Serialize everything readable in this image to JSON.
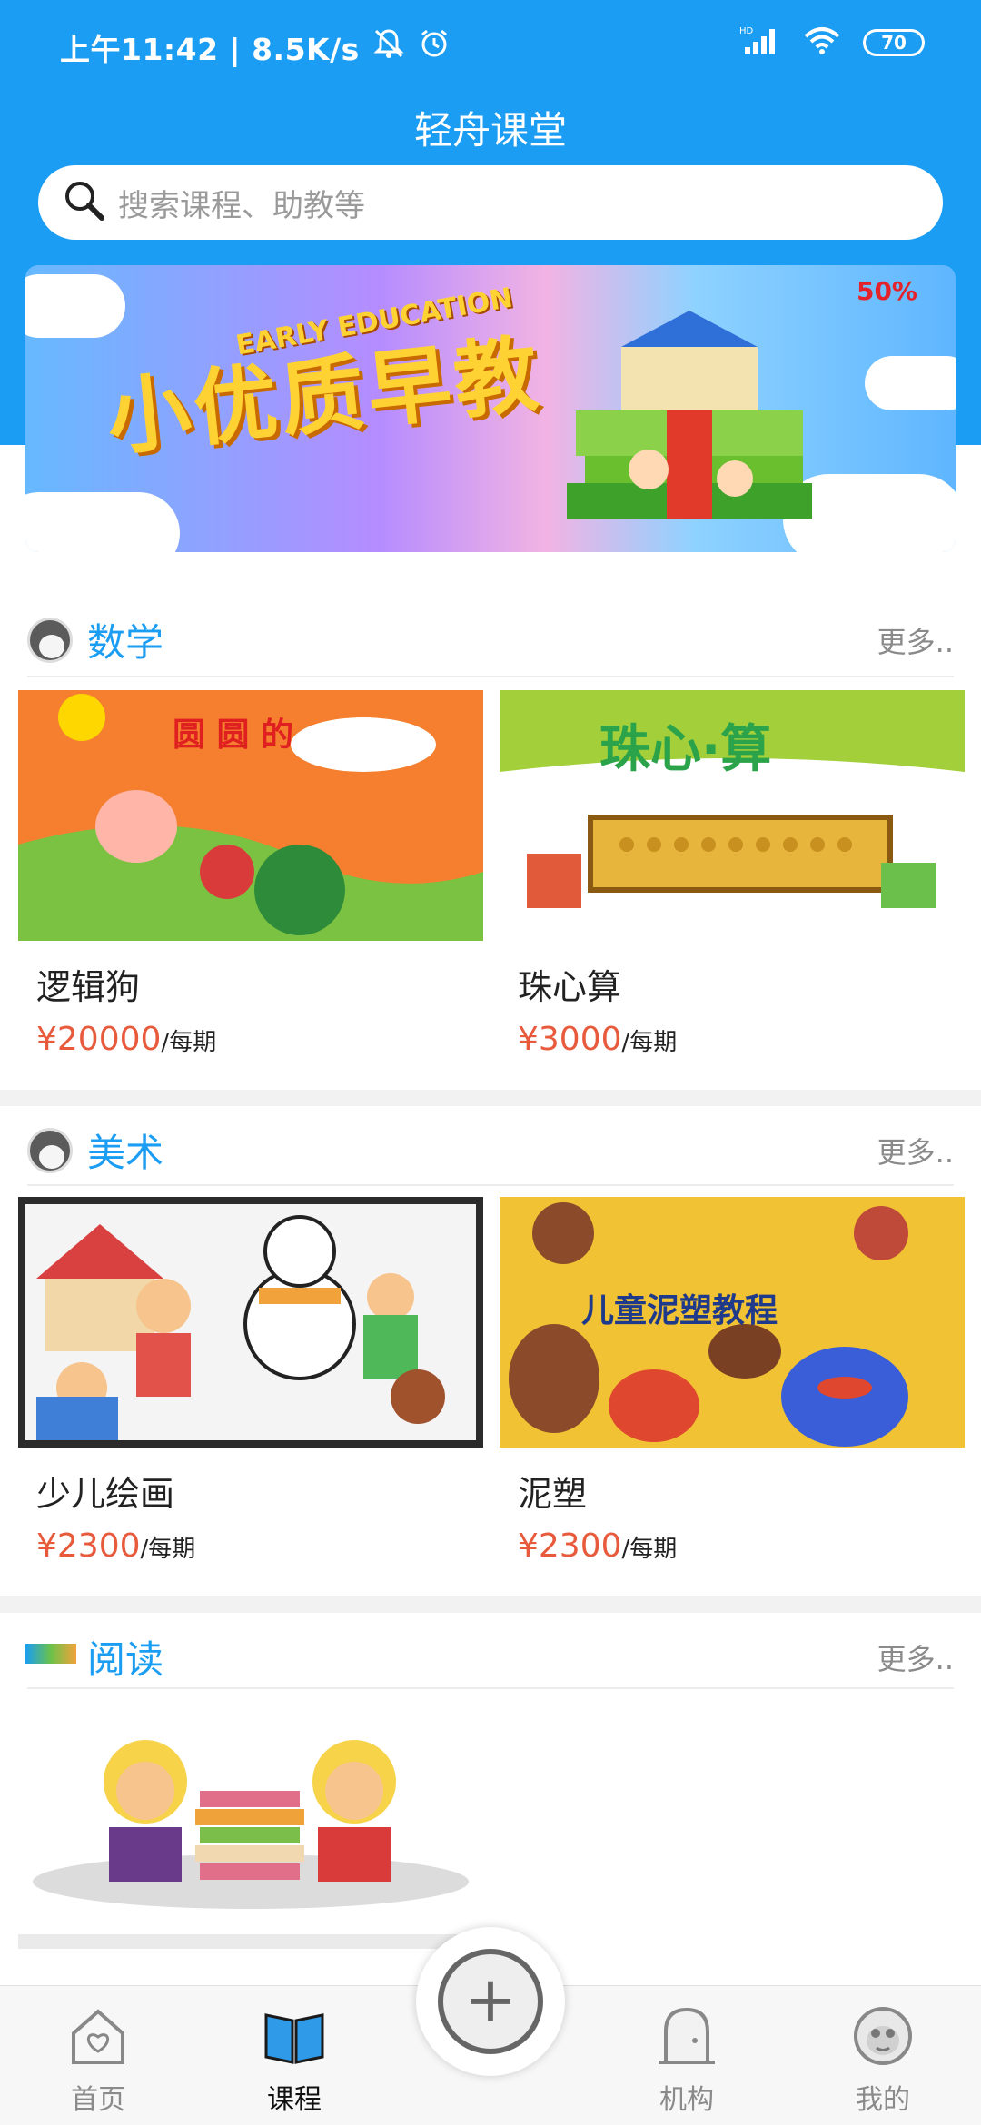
{
  "status_bar": {
    "time_info": "上午11:42 | 8.5K/s",
    "network": "HD",
    "battery": "70"
  },
  "header": {
    "title": "轻舟课堂",
    "search_placeholder": "搜索课程、助教等"
  },
  "banner": {
    "title_art": "小优质早教",
    "sub_art": "EARLY EDUCATION",
    "badge": "50%"
  },
  "sections": [
    {
      "title": "数学",
      "more": "更多..",
      "cards": [
        {
          "name": "逻辑狗",
          "price": "¥20000",
          "per": "/每期"
        },
        {
          "name": "珠心算",
          "price": "¥3000",
          "per": "/每期"
        }
      ]
    },
    {
      "title": "美术",
      "more": "更多..",
      "cards": [
        {
          "name": "少儿绘画",
          "price": "¥2300",
          "per": "/每期"
        },
        {
          "name": "泥塑",
          "price": "¥2300",
          "per": "/每期"
        }
      ]
    },
    {
      "title": "阅读",
      "more": "更多..",
      "cards": []
    }
  ],
  "card_art": {
    "c0": "圆 圆 的",
    "c1": "珠心·算",
    "c3": "儿童泥塑教程"
  },
  "bottom_nav": [
    {
      "label": "首页",
      "icon": "home-heart-icon",
      "active": false
    },
    {
      "label": "课程",
      "icon": "book-icon",
      "active": true
    },
    {
      "label": "机构",
      "icon": "building-door-icon",
      "active": false
    },
    {
      "label": "我的",
      "icon": "monkey-avatar-icon",
      "active": false
    }
  ],
  "colors": {
    "primary": "#1a9df2",
    "price": "#e85a3c",
    "muted": "#8a8a8a"
  }
}
